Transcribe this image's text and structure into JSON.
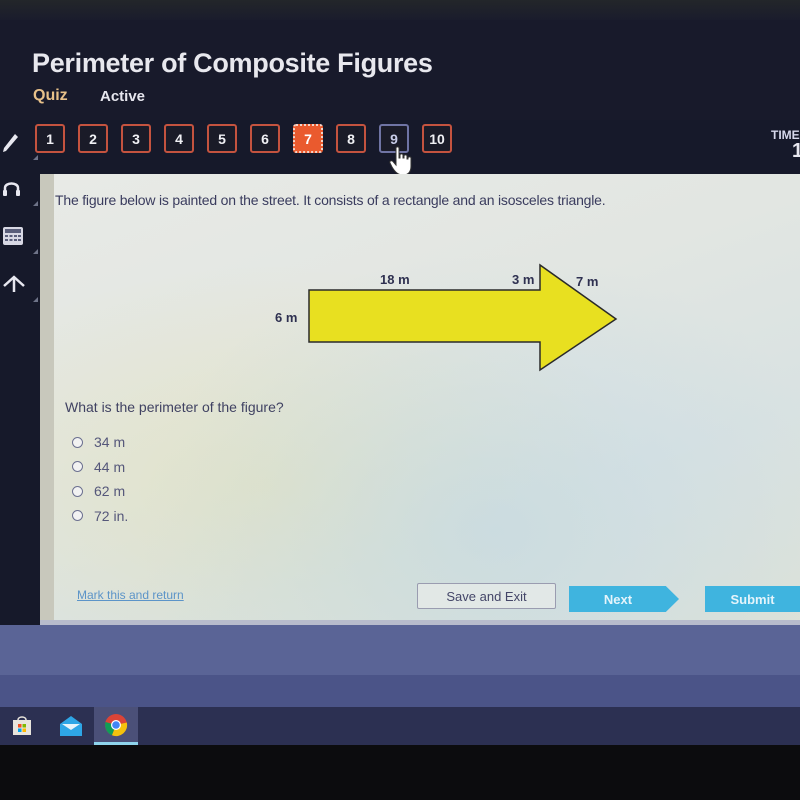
{
  "header": {
    "title": "Perimeter of Composite Figures",
    "quiz_label": "Quiz",
    "status": "Active"
  },
  "question_nav": {
    "items": [
      "1",
      "2",
      "3",
      "4",
      "5",
      "6",
      "7",
      "8",
      "9",
      "10"
    ],
    "current": "7",
    "hovered": "9"
  },
  "timer": {
    "label": "TIME",
    "value": "1"
  },
  "left_rail": {
    "icons": [
      "pencil-icon",
      "headphones-icon",
      "calculator-icon",
      "arrow-up-icon"
    ]
  },
  "content": {
    "prompt": "The figure below is painted on the street. It consists of a rectangle and an isosceles triangle.",
    "figure": {
      "shape": "arrow (rectangle + isosceles triangle)",
      "fill_color": "#e8e020",
      "labels": {
        "top": "18 m",
        "left": "6 m",
        "notch": "3 m",
        "slant": "7 m"
      }
    },
    "question": "What is the perimeter of the figure?",
    "options": [
      "34 m",
      "44 m",
      "62 m",
      "72 in."
    ]
  },
  "footer": {
    "mark_link": "Mark this and return",
    "save_label": "Save and Exit",
    "next_label": "Next",
    "submit_label": "Submit"
  },
  "colors": {
    "current_question": "#ea5a2e",
    "question_border": "#c4533f",
    "primary_button": "#3fb4df",
    "quiz_label": "#e8c18a"
  },
  "taskbar": {
    "apps": [
      "microsoft-store",
      "mail",
      "chrome"
    ],
    "active_app": "chrome"
  }
}
